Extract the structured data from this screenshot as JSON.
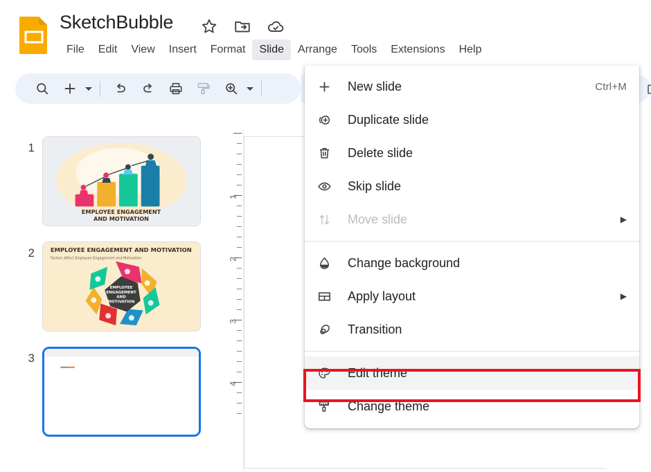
{
  "app": {
    "logo_icon": "google-slides-logo",
    "doc_title": "SketchBubble",
    "title_icons": [
      {
        "name": "star-icon",
        "label": "Star"
      },
      {
        "name": "folder-move-icon",
        "label": "Move to folder"
      },
      {
        "name": "cloud-saved-icon",
        "label": "Saved to Drive"
      }
    ]
  },
  "menubar": {
    "items": [
      {
        "label": "File",
        "active": false
      },
      {
        "label": "Edit",
        "active": false
      },
      {
        "label": "View",
        "active": false
      },
      {
        "label": "Insert",
        "active": false
      },
      {
        "label": "Format",
        "active": false
      },
      {
        "label": "Slide",
        "active": true
      },
      {
        "label": "Arrange",
        "active": false
      },
      {
        "label": "Tools",
        "active": false
      },
      {
        "label": "Extensions",
        "active": false
      },
      {
        "label": "Help",
        "active": false
      }
    ]
  },
  "toolbar": {
    "buttons": [
      {
        "name": "search-icon",
        "label": "Search"
      },
      {
        "name": "new-slide-icon",
        "label": "New slide"
      },
      {
        "name": "new-slide-caret-icon",
        "label": "New slide options"
      },
      {
        "name": "undo-icon",
        "label": "Undo"
      },
      {
        "name": "redo-icon",
        "label": "Redo"
      },
      {
        "name": "print-icon",
        "label": "Print"
      },
      {
        "name": "paint-format-icon",
        "label": "Paint format"
      },
      {
        "name": "zoom-icon",
        "label": "Zoom"
      },
      {
        "name": "zoom-caret-icon",
        "label": "Zoom options"
      }
    ]
  },
  "filmstrip": {
    "slides": [
      {
        "number": "1",
        "selected": false,
        "title": "EMPLOYEE ENGAGEMENT AND MOTIVATION",
        "thumb": "bar-chart-people"
      },
      {
        "number": "2",
        "selected": false,
        "title": "EMPLOYEE ENGAGEMENT AND MOTIVATION",
        "subtitle": "Factors Affect Employee Engagement and Motivation",
        "center_label": "EMPLOYEE ENGAGEMENT AND MOTIVATION",
        "thumb": "heptagon-diagram"
      },
      {
        "number": "3",
        "selected": true,
        "title": "",
        "thumb": "blank-slide"
      }
    ]
  },
  "ruler": {
    "orientation": "vertical",
    "unit": "inches",
    "labels": [
      "1",
      "2",
      "3",
      "4"
    ]
  },
  "slide_menu": {
    "title": "Slide",
    "groups": [
      {
        "items": [
          {
            "label": "New slide",
            "icon": "plus-icon",
            "accel": "Ctrl+M",
            "disabled": false,
            "submenu": false,
            "highlighted": false
          },
          {
            "label": "Duplicate slide",
            "icon": "duplicate-icon",
            "accel": "",
            "disabled": false,
            "submenu": false,
            "highlighted": false
          },
          {
            "label": "Delete slide",
            "icon": "trash-icon",
            "accel": "",
            "disabled": false,
            "submenu": false,
            "highlighted": false
          },
          {
            "label": "Skip slide",
            "icon": "eye-icon",
            "accel": "",
            "disabled": false,
            "submenu": false,
            "highlighted": false
          },
          {
            "label": "Move slide",
            "icon": "move-slide-icon",
            "accel": "",
            "disabled": true,
            "submenu": true,
            "highlighted": false
          }
        ]
      },
      {
        "items": [
          {
            "label": "Change background",
            "icon": "water-drop-icon",
            "accel": "",
            "disabled": false,
            "submenu": false,
            "highlighted": false
          },
          {
            "label": "Apply layout",
            "icon": "layout-icon",
            "accel": "",
            "disabled": false,
            "submenu": true,
            "highlighted": false
          },
          {
            "label": "Transition",
            "icon": "transition-icon",
            "accel": "",
            "disabled": false,
            "submenu": false,
            "highlighted": false
          }
        ]
      },
      {
        "items": [
          {
            "label": "Edit theme",
            "icon": "palette-icon",
            "accel": "",
            "disabled": false,
            "submenu": false,
            "highlighted": true
          },
          {
            "label": "Change theme",
            "icon": "paint-roller-icon",
            "accel": "",
            "disabled": false,
            "submenu": false,
            "highlighted": false
          }
        ]
      }
    ],
    "submenu_arrow": "▶"
  },
  "annotation": {
    "name": "edit-theme-highlight",
    "target": "Edit theme",
    "color": "#e8151e"
  },
  "colors": {
    "accent_blue": "#1a73e8",
    "toolbar_bg": "#edf2fa",
    "menu_active_bg": "#e8eaed",
    "highlight_red": "#e8151e",
    "text_primary": "#202124",
    "text_secondary": "#5f6368"
  }
}
